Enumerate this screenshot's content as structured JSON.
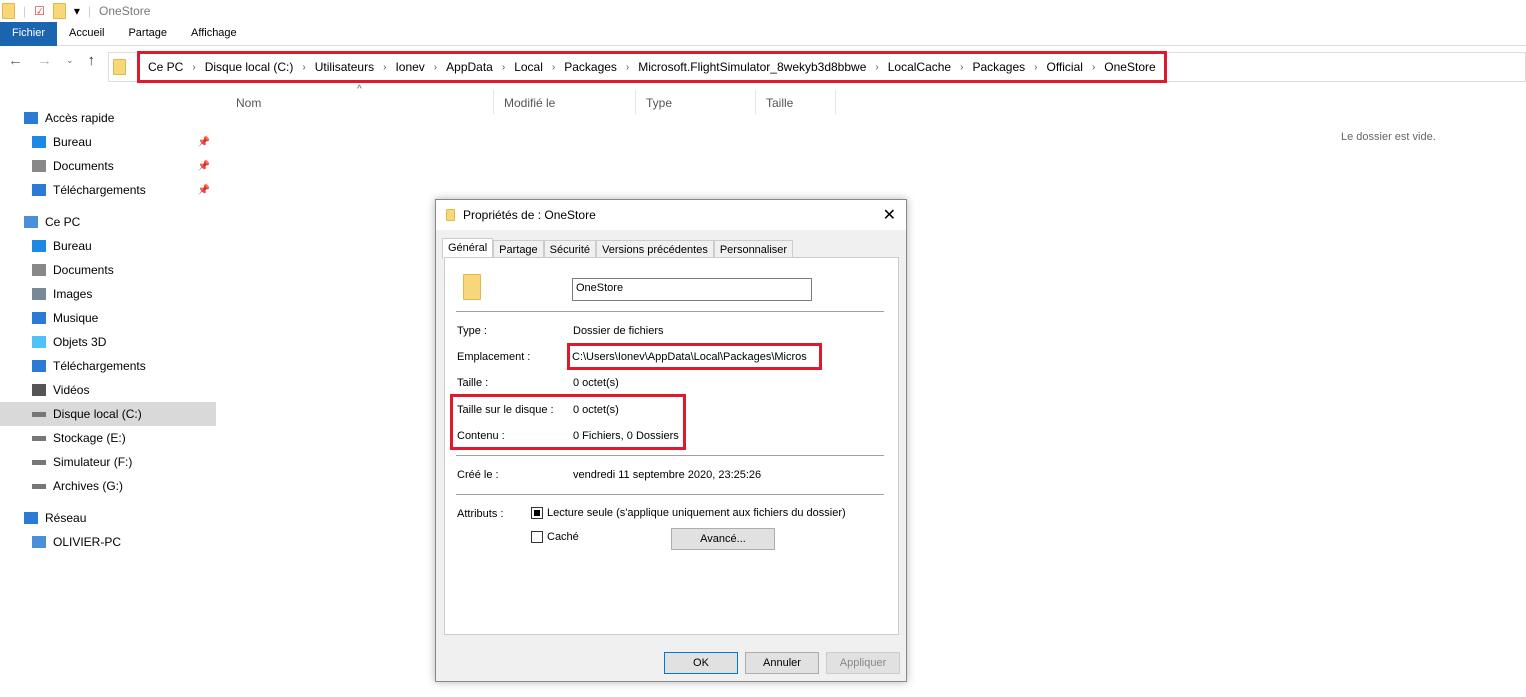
{
  "window": {
    "title": "OneStore"
  },
  "ribbon": {
    "tabs": [
      "Fichier",
      "Accueil",
      "Partage",
      "Affichage"
    ]
  },
  "address": {
    "crumbs": [
      "Ce PC",
      "Disque local (C:)",
      "Utilisateurs",
      "Ionev",
      "AppData",
      "Local",
      "Packages",
      "Microsoft.FlightSimulator_8wekyb3d8bbwe",
      "LocalCache",
      "Packages",
      "Official",
      "OneStore"
    ]
  },
  "columns": [
    "Nom",
    "Modifié le",
    "Type",
    "Taille"
  ],
  "empty_message": "Le dossier est vide.",
  "sidebar": {
    "items": [
      {
        "label": "Accès rapide",
        "level": 0,
        "icon": "star-icon"
      },
      {
        "label": "Bureau",
        "level": 1,
        "icon": "desktop-icon",
        "pinned": true
      },
      {
        "label": "Documents",
        "level": 1,
        "icon": "documents-icon",
        "pinned": true
      },
      {
        "label": "Téléchargements",
        "level": 1,
        "icon": "download-icon",
        "pinned": true
      },
      {
        "label": "Ce PC",
        "level": 0,
        "icon": "computer-icon"
      },
      {
        "label": "Bureau",
        "level": 1,
        "icon": "desktop-icon"
      },
      {
        "label": "Documents",
        "level": 1,
        "icon": "documents-icon"
      },
      {
        "label": "Images",
        "level": 1,
        "icon": "images-icon"
      },
      {
        "label": "Musique",
        "level": 1,
        "icon": "music-icon"
      },
      {
        "label": "Objets 3D",
        "level": 1,
        "icon": "cube-icon"
      },
      {
        "label": "Téléchargements",
        "level": 1,
        "icon": "download-icon"
      },
      {
        "label": "Vidéos",
        "level": 1,
        "icon": "video-icon"
      },
      {
        "label": "Disque local (C:)",
        "level": 1,
        "icon": "drive-icon",
        "selected": true
      },
      {
        "label": "Stockage (E:)",
        "level": 1,
        "icon": "drive-icon"
      },
      {
        "label": "Simulateur (F:)",
        "level": 1,
        "icon": "drive-icon"
      },
      {
        "label": "Archives (G:)",
        "level": 1,
        "icon": "drive-icon"
      },
      {
        "label": "Réseau",
        "level": 0,
        "icon": "network-icon"
      },
      {
        "label": "OLIVIER-PC",
        "level": 1,
        "icon": "computer-icon"
      }
    ]
  },
  "dialog": {
    "title": "Propriétés de : OneStore",
    "tabs": [
      "Général",
      "Partage",
      "Sécurité",
      "Versions précédentes",
      "Personnaliser"
    ],
    "name_value": "OneStore",
    "type_label": "Type :",
    "type_value": "Dossier de fichiers",
    "location_label": "Emplacement :",
    "location_value": "C:\\Users\\Ionev\\AppData\\Local\\Packages\\Micros",
    "size_label": "Taille :",
    "size_value": "0 octet(s)",
    "disk_size_label": "Taille sur le disque :",
    "disk_size_value": "0 octet(s)",
    "contents_label": "Contenu :",
    "contents_value": "0 Fichiers, 0 Dossiers",
    "created_label": "Créé le :",
    "created_value": "vendredi 11 septembre 2020, 23:25:26",
    "attributes_label": "Attributs :",
    "readonly_label": "Lecture seule (s'applique uniquement aux fichiers du dossier)",
    "hidden_label": "Caché",
    "advanced_button": "Avancé...",
    "ok_button": "OK",
    "cancel_button": "Annuler",
    "apply_button": "Appliquer"
  },
  "colors": {
    "highlight": "#e0192a",
    "file_tab": "#1a64b0"
  }
}
